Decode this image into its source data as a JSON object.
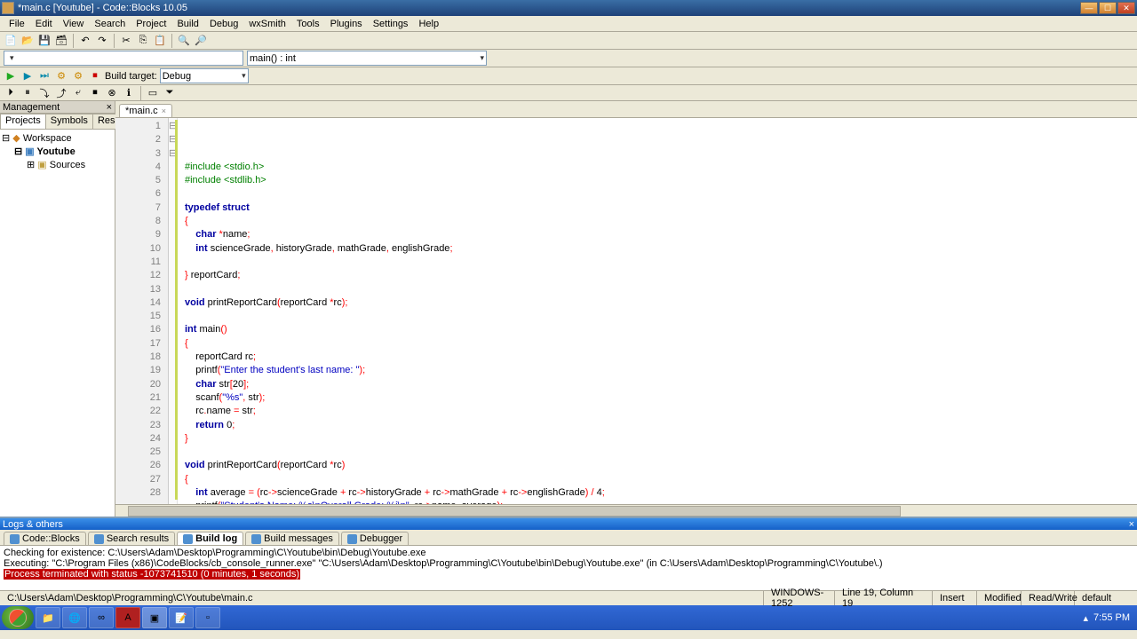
{
  "title": "*main.c [Youtube] - Code::Blocks 10.05",
  "menu": [
    "File",
    "Edit",
    "View",
    "Search",
    "Project",
    "Build",
    "Debug",
    "wxSmith",
    "Tools",
    "Plugins",
    "Settings",
    "Help"
  ],
  "toolbar2": {
    "combo1": "",
    "combo2": "main() : int"
  },
  "toolbar3": {
    "label": "Build target:",
    "target": "Debug"
  },
  "management": {
    "title": "Management",
    "tabs": [
      "Projects",
      "Symbols",
      "Resou"
    ],
    "tree": {
      "workspace": "Workspace",
      "project": "Youtube",
      "folder": "Sources"
    }
  },
  "file_tab": "*main.c",
  "code": {
    "lines": [
      {
        "n": 1,
        "html": "<span class='pp'>#include &lt;stdio.h&gt;</span>"
      },
      {
        "n": 2,
        "html": "<span class='pp'>#include &lt;stdlib.h&gt;</span>"
      },
      {
        "n": 3,
        "html": ""
      },
      {
        "n": 4,
        "html": "<span class='kw'>typedef</span> <span class='kw'>struct</span>"
      },
      {
        "n": 5,
        "html": "<span class='op'>{</span>",
        "fold": "⊟"
      },
      {
        "n": 6,
        "html": "    <span class='kw'>char</span> <span class='op'>*</span>name<span class='op'>;</span>"
      },
      {
        "n": 7,
        "html": "    <span class='kw'>int</span> scienceGrade<span class='op'>,</span> historyGrade<span class='op'>,</span> mathGrade<span class='op'>,</span> englishGrade<span class='op'>;</span>"
      },
      {
        "n": 8,
        "html": ""
      },
      {
        "n": 9,
        "html": "<span class='op'>}</span> reportCard<span class='op'>;</span>"
      },
      {
        "n": 10,
        "html": ""
      },
      {
        "n": 11,
        "html": "<span class='kw'>void</span> printReportCard<span class='op'>(</span>reportCard <span class='op'>*</span>rc<span class='op'>);</span>"
      },
      {
        "n": 12,
        "html": ""
      },
      {
        "n": 13,
        "html": "<span class='kw'>int</span> main<span class='op'>()</span>"
      },
      {
        "n": 14,
        "html": "<span class='op'>{</span>",
        "fold": "⊟"
      },
      {
        "n": 15,
        "html": "    reportCard rc<span class='op'>;</span>"
      },
      {
        "n": 16,
        "html": "    printf<span class='op'>(</span><span class='str'>\"Enter the student's last name: \"</span><span class='op'>);</span>"
      },
      {
        "n": 17,
        "html": "    <span class='kw'>char</span> str<span class='op'>[</span>20<span class='op'>];</span>"
      },
      {
        "n": 18,
        "html": "    scanf<span class='op'>(</span><span class='str'>\"%s\"</span><span class='op'>,</span> str<span class='op'>);</span>"
      },
      {
        "n": 19,
        "html": "    rc<span class='op'>.</span>name <span class='op'>=</span> str<span class='op'>;</span>"
      },
      {
        "n": 20,
        "html": "    <span class='kw'>return</span> 0<span class='op'>;</span>"
      },
      {
        "n": 21,
        "html": "<span class='op'>}</span>"
      },
      {
        "n": 22,
        "html": ""
      },
      {
        "n": 23,
        "html": "<span class='kw'>void</span> printReportCard<span class='op'>(</span>reportCard <span class='op'>*</span>rc<span class='op'>)</span>"
      },
      {
        "n": 24,
        "html": "<span class='op'>{</span>",
        "fold": "⊟"
      },
      {
        "n": 25,
        "html": "    <span class='kw'>int</span> average <span class='op'>=</span> <span class='op'>(</span>rc<span class='op'>-&gt;</span>scienceGrade <span class='op'>+</span> rc<span class='op'>-&gt;</span>historyGrade <span class='op'>+</span> rc<span class='op'>-&gt;</span>mathGrade <span class='op'>+</span> rc<span class='op'>-&gt;</span>englishGrade<span class='op'>)</span> <span class='op'>/</span> 4<span class='op'>;</span>"
      },
      {
        "n": 26,
        "html": "    printf<span class='op'>(</span><span class='str'>\"Student's Name: %s\\nOverall Grade: %i\\n\"</span><span class='op'>,</span> rc<span class='op'>-&gt;</span>name<span class='op'>,</span> average<span class='op'>);</span>"
      },
      {
        "n": 27,
        "html": "<span class='op'>}</span>"
      },
      {
        "n": 28,
        "html": ""
      }
    ]
  },
  "bottom": {
    "title": "Logs & others",
    "tabs": [
      "Code::Blocks",
      "Search results",
      "Build log",
      "Build messages",
      "Debugger"
    ],
    "active_tab": 2,
    "log": {
      "line1": "Checking for existence: C:\\Users\\Adam\\Desktop\\Programming\\C\\Youtube\\bin\\Debug\\Youtube.exe",
      "line2": "Executing: \"C:\\Program Files (x86)\\CodeBlocks/cb_console_runner.exe\" \"C:\\Users\\Adam\\Desktop\\Programming\\C\\Youtube\\bin\\Debug\\Youtube.exe\"  (in C:\\Users\\Adam\\Desktop\\Programming\\C\\Youtube\\.)",
      "line3": "Process terminated with status -1073741510 (0 minutes, 1 seconds)"
    }
  },
  "status": {
    "path": "C:\\Users\\Adam\\Desktop\\Programming\\C\\Youtube\\main.c",
    "encoding": "WINDOWS-1252",
    "pos": "Line 19, Column 19",
    "mode": "Insert",
    "modified": "Modified",
    "rw": "Read/Write",
    "scheme": "default"
  },
  "clock": "7:55 PM"
}
